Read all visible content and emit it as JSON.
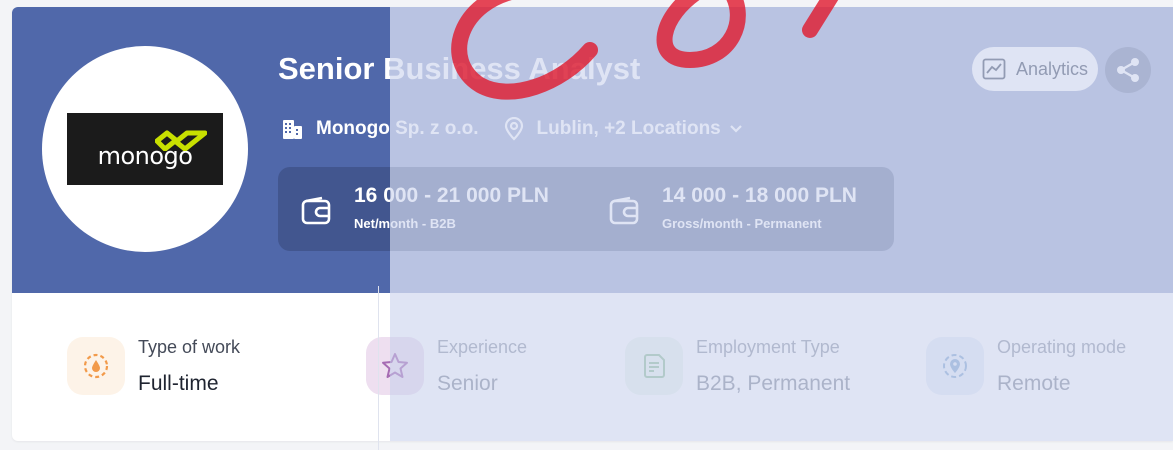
{
  "job": {
    "title": "Senior Business Analyst",
    "company": "Monogo Sp. z o.o.",
    "location": "Lublin, +2 Locations",
    "logo_text": "monogo"
  },
  "salaries": [
    {
      "amount": "16 000 - 21 000 PLN",
      "detail": "Net/month - B2B"
    },
    {
      "amount": "14 000 - 18 000 PLN",
      "detail": "Gross/month - Permanent"
    }
  ],
  "actions": {
    "analytics_label": "Analytics"
  },
  "details": [
    {
      "label": "Type of work",
      "value": "Full-time",
      "icon": "gauge-icon"
    },
    {
      "label": "Experience",
      "value": "Senior",
      "icon": "star-icon"
    },
    {
      "label": "Employment Type",
      "value": "B2B, Permanent",
      "icon": "contract-icon"
    },
    {
      "label": "Operating mode",
      "value": "Remote",
      "icon": "location-pin-icon"
    }
  ],
  "colors": {
    "banner": "#5068aa",
    "accent_red": "#e0192d",
    "logo_accent": "#c8e000"
  }
}
